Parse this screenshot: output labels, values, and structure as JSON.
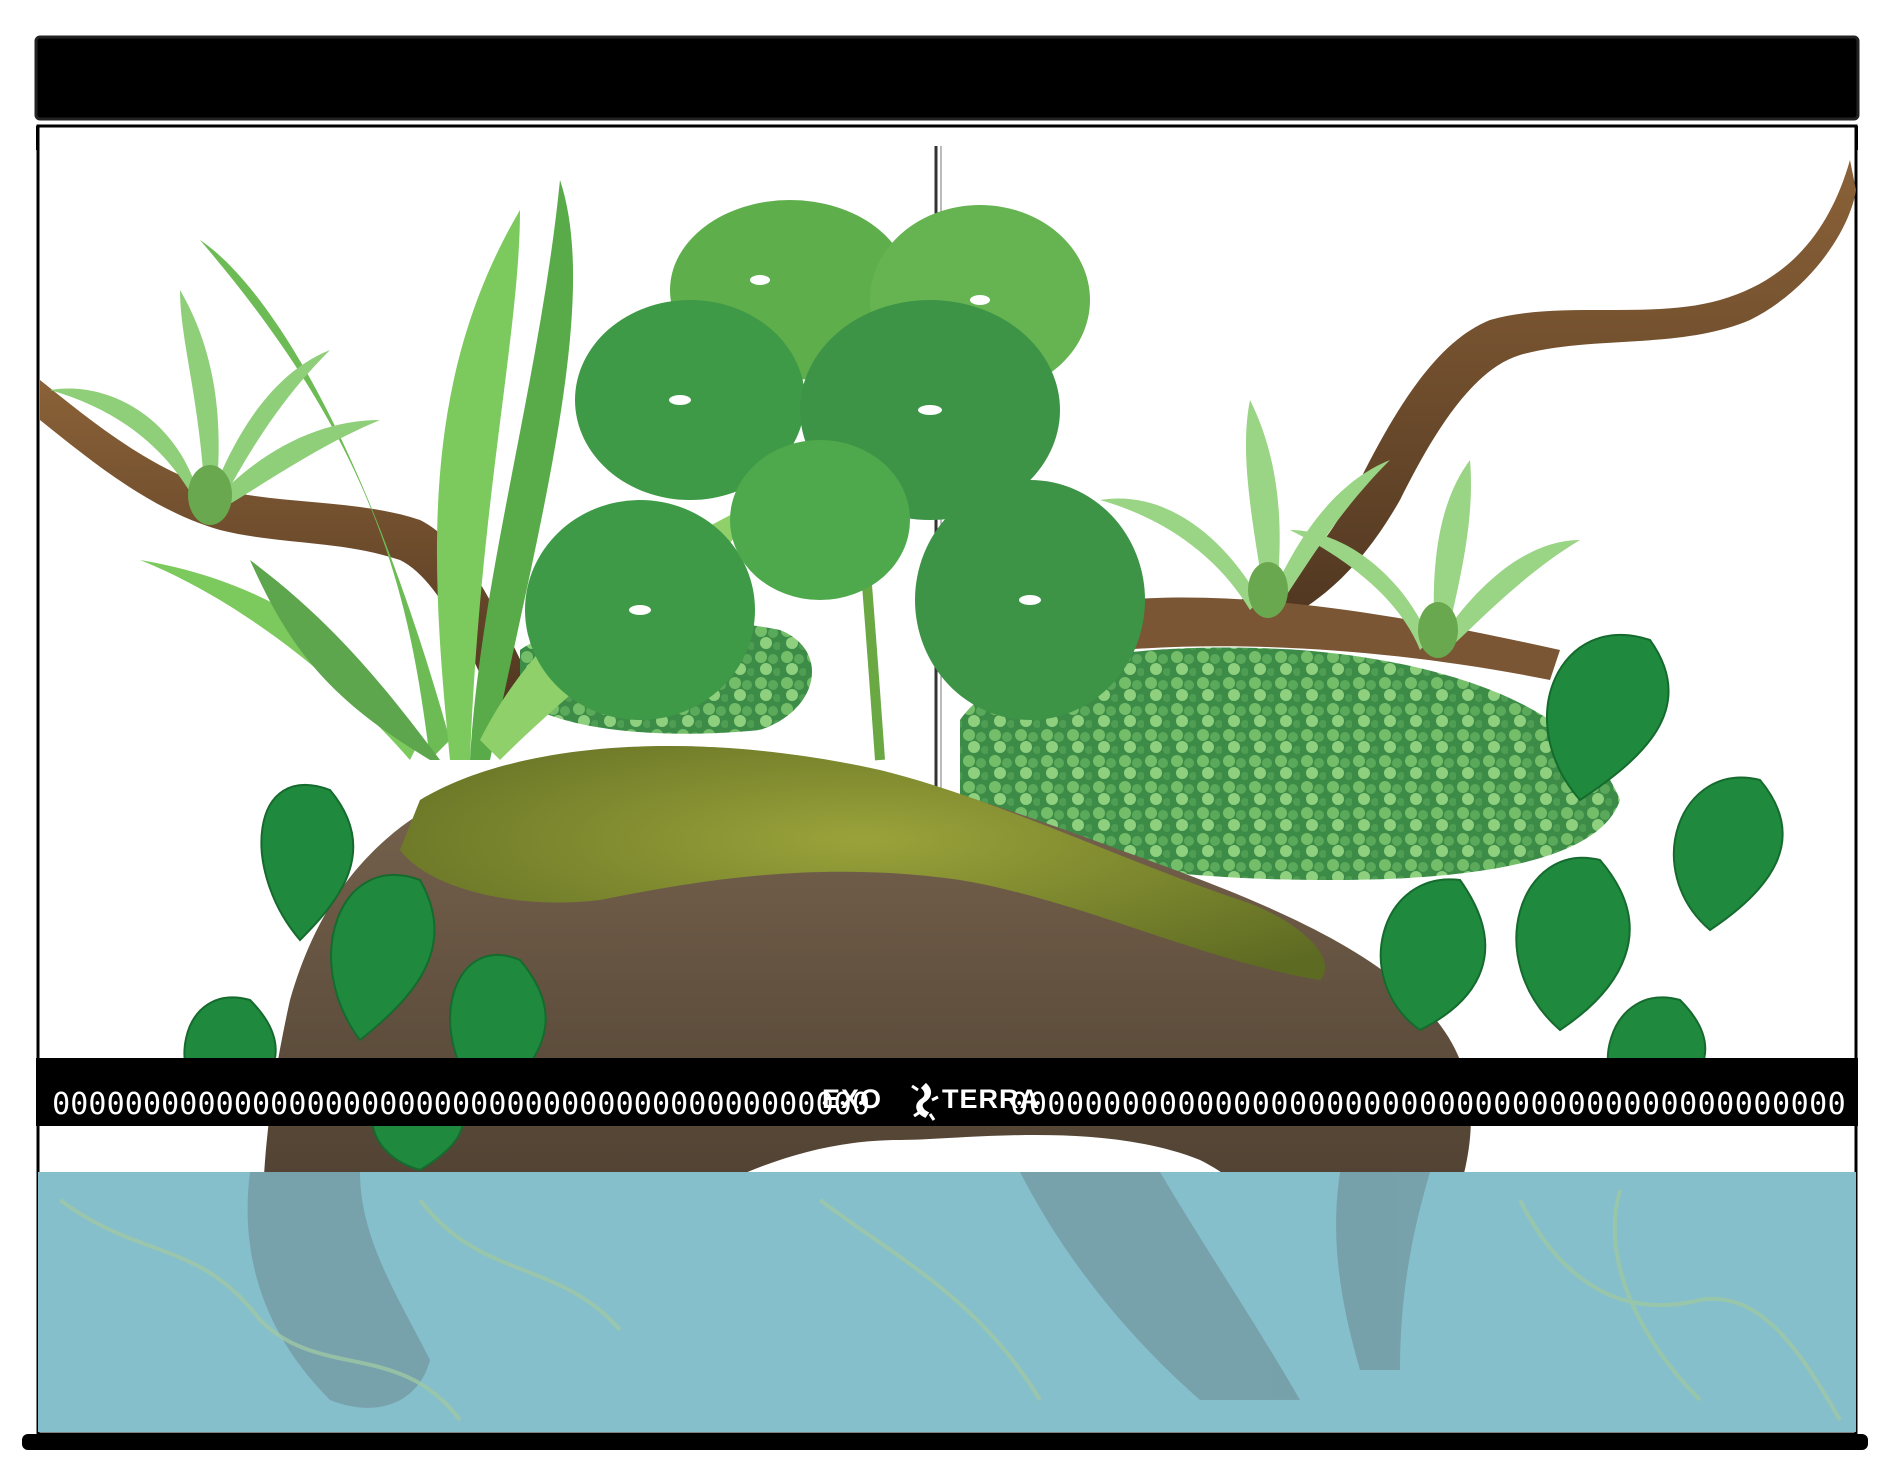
{
  "brand": {
    "name_left": "EXO",
    "name_right": "TERRA",
    "mark_icon": "gecko-icon"
  },
  "vent": {
    "left_slots": 45,
    "right_slots": 45,
    "slot_glyph": "0"
  },
  "colors": {
    "frame": "#000000",
    "water": "#86bfcc",
    "leaf_dark": "#2e8b4a",
    "leaf_light": "#6dbb55",
    "moss": "#7d8a30",
    "wood": "#6b4a2c"
  },
  "water_level": 0.82
}
